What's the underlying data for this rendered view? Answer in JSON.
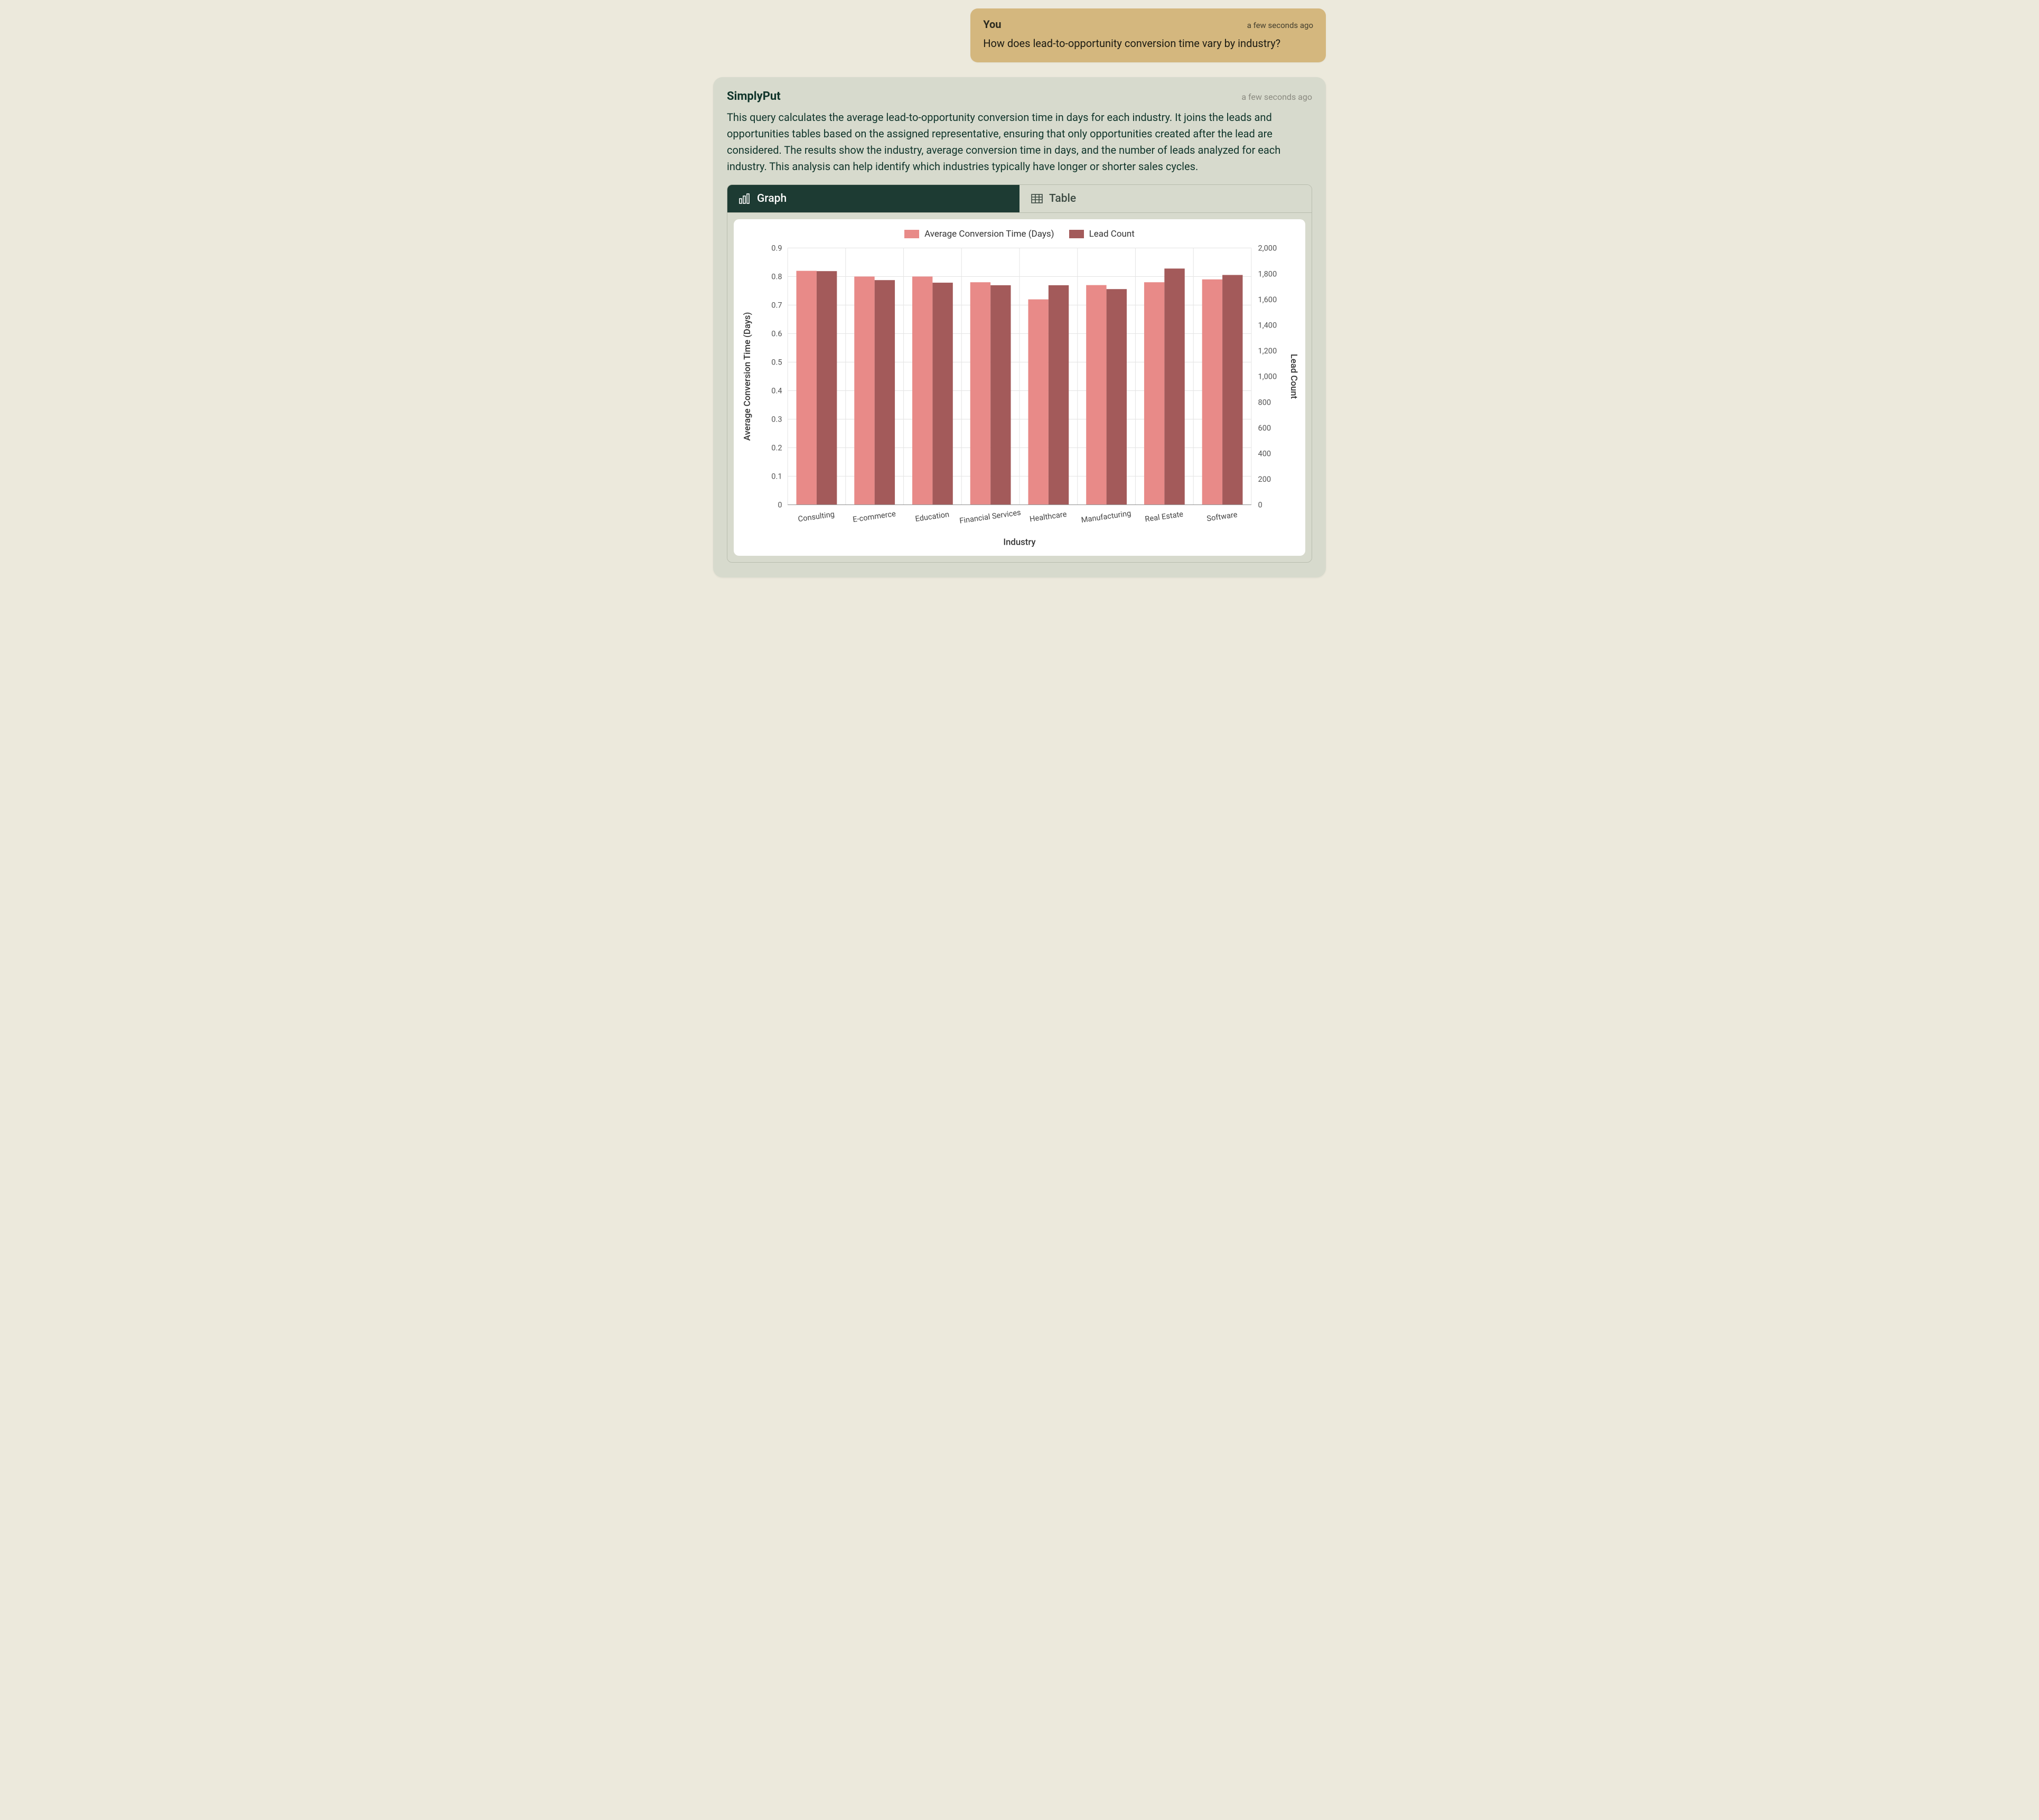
{
  "user_message": {
    "author": "You",
    "time": "a few seconds ago",
    "text": "How does lead-to-opportunity conversion time vary by industry?"
  },
  "assistant_message": {
    "author": "SimplyPut",
    "time": "a few seconds ago",
    "text": "This query calculates the average lead-to-opportunity conversion time in days for each industry. It joins the leads and opportunities tables based on the assigned representative, ensuring that only opportunities created after the lead are considered. The results show the industry, average conversion time in days, and the number of leads analyzed for each industry. This analysis can help identify which industries typically have longer or shorter sales cycles."
  },
  "tabs": {
    "graph": "Graph",
    "table": "Table"
  },
  "chart_data": {
    "type": "bar",
    "title": "",
    "xlabel": "Industry",
    "y_left": {
      "label": "Average Conversion Time (Days)",
      "min": 0,
      "max": 0.9,
      "step": 0.1,
      "ticks": [
        0,
        0.1,
        0.2,
        0.3,
        0.4,
        0.5,
        0.6,
        0.7,
        0.8,
        0.9
      ]
    },
    "y_right": {
      "label": "Lead Count",
      "min": 0,
      "max": 2000,
      "step": 200,
      "ticks": [
        0,
        200,
        400,
        600,
        800,
        1000,
        1200,
        1400,
        1600,
        1800,
        2000
      ]
    },
    "categories": [
      "Consulting",
      "E-commerce",
      "Education",
      "Financial Services",
      "Healthcare",
      "Manufacturing",
      "Real Estate",
      "Software"
    ],
    "series": [
      {
        "name": "Average Conversion Time (Days)",
        "axis": "left",
        "color": "#e88a88",
        "values": [
          0.82,
          0.8,
          0.8,
          0.78,
          0.72,
          0.77,
          0.78,
          0.79
        ]
      },
      {
        "name": "Lead Count",
        "axis": "right",
        "color": "#a35a5a",
        "values": [
          1820,
          1750,
          1730,
          1710,
          1710,
          1680,
          1840,
          1790
        ]
      }
    ],
    "legend_position": "top",
    "grid": true
  }
}
